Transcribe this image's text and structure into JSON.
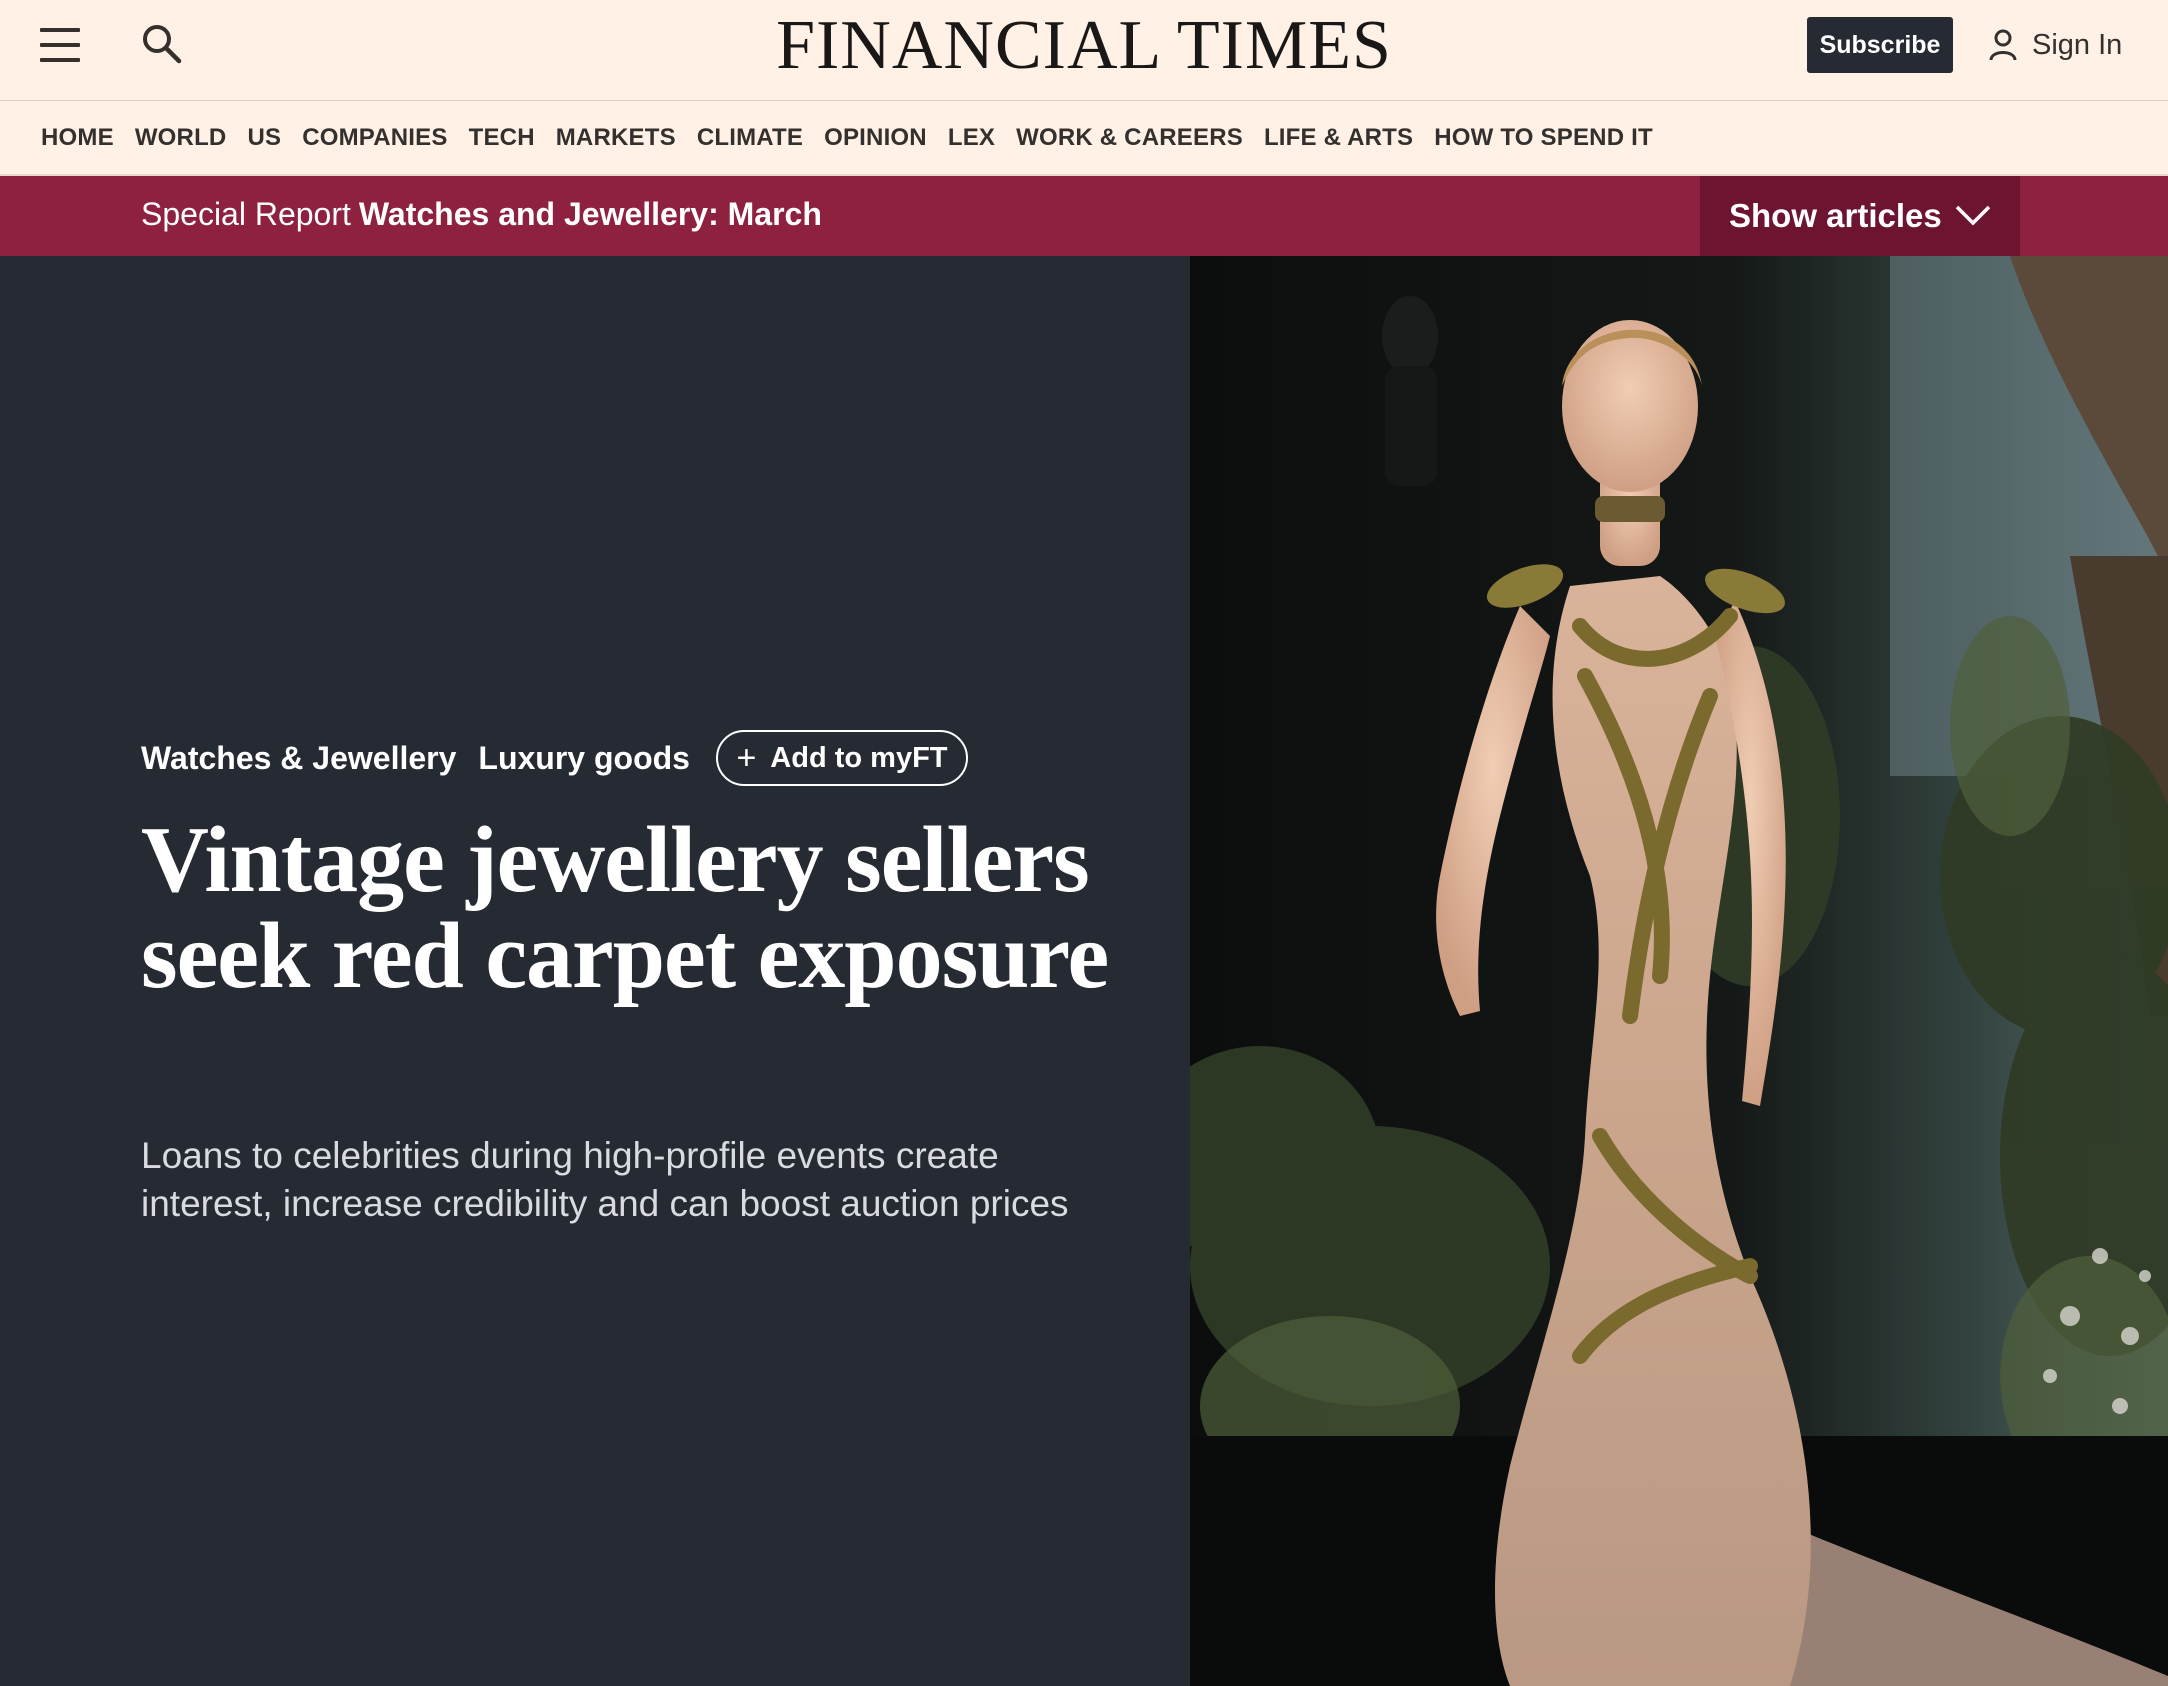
{
  "header": {
    "masthead": "FINANCIAL TIMES",
    "subscribe_label": "Subscribe",
    "signin_label": "Sign In"
  },
  "nav": {
    "items": [
      "HOME",
      "WORLD",
      "US",
      "COMPANIES",
      "TECH",
      "MARKETS",
      "CLIMATE",
      "OPINION",
      "LEX",
      "WORK & CAREERS",
      "LIFE & ARTS",
      "HOW TO SPEND IT"
    ]
  },
  "banner": {
    "prefix": "Special Report",
    "title": "Watches and Jewellery: March",
    "show_articles_label": "Show articles"
  },
  "article": {
    "tags": [
      "Watches & Jewellery",
      "Luxury goods"
    ],
    "myft_label": "Add to myFT",
    "headline": "Vintage jewellery sellers seek red carpet exposure",
    "standfirst": "Loans to celebrities during high-profile events create interest, increase credibility and can boost auction prices"
  },
  "colors": {
    "page_bg": "#fff1e5",
    "banner": "#8d213f",
    "banner_button": "#6c1430",
    "hero_bg": "#262a33",
    "subscribe_bg": "#262a33"
  },
  "icons": {
    "menu": "hamburger-menu-icon",
    "search": "search-icon",
    "user": "user-icon",
    "chevron": "chevron-down-icon",
    "plus": "plus-icon"
  }
}
